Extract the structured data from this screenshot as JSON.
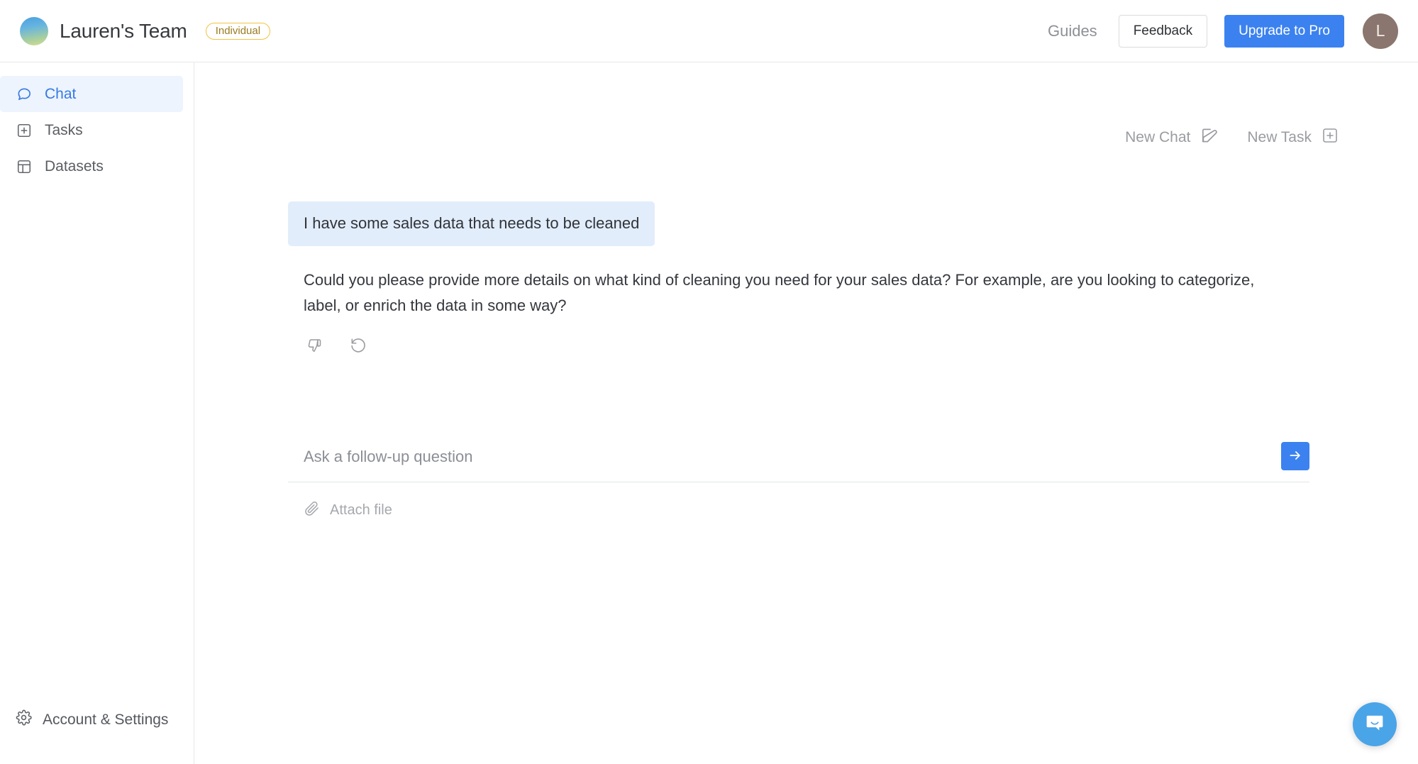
{
  "header": {
    "brand_name": "Lauren's Team",
    "plan_badge": "Individual",
    "guides_label": "Guides",
    "feedback_label": "Feedback",
    "upgrade_label": "Upgrade to Pro",
    "avatar_initial": "L",
    "avatar_color": "#8a766e",
    "accent_color": "#3b82f0",
    "badge_border_color": "#f0c341",
    "badge_text_color": "#9a7b20"
  },
  "sidebar": {
    "items": [
      {
        "label": "Chat",
        "icon": "chat-bubble-icon",
        "active": true
      },
      {
        "label": "Tasks",
        "icon": "plus-square-icon",
        "active": false
      },
      {
        "label": "Datasets",
        "icon": "table-grid-icon",
        "active": false
      }
    ],
    "settings_label": "Account & Settings",
    "settings_icon": "gear-icon",
    "active_bg": "#edf4fd",
    "active_fg": "#3779e3"
  },
  "main": {
    "actions": [
      {
        "label": "New Chat",
        "icon": "pencil-square-icon"
      },
      {
        "label": "New Task",
        "icon": "plus-square-icon"
      }
    ],
    "messages": [
      {
        "role": "user",
        "text": "I have some sales data that needs to be cleaned"
      },
      {
        "role": "assistant",
        "text": "Could you please provide more details on what kind of cleaning you need for your sales data? For example, are you looking to categorize, label, or enrich the data in some way?"
      }
    ],
    "message_tools": [
      {
        "name": "thumbs-down-icon"
      },
      {
        "name": "regenerate-icon"
      }
    ],
    "composer": {
      "placeholder": "Ask a follow-up question",
      "value": "",
      "send_icon": "arrow-right-icon",
      "attach_label": "Attach file",
      "attach_icon": "paperclip-icon"
    },
    "user_bubble_bg": "#e2edfb"
  },
  "messenger": {
    "icon": "messenger-bubble-icon",
    "color": "#4aa4e8"
  }
}
